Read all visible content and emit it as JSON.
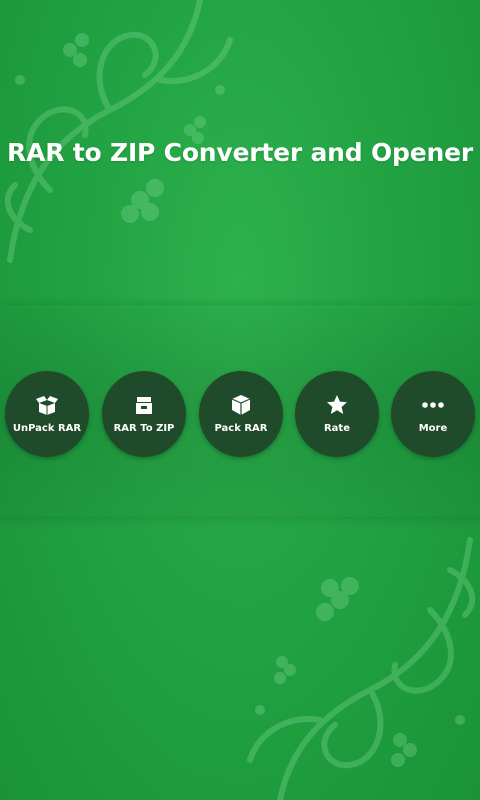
{
  "app": {
    "title": "RAR to ZIP Converter and Opener"
  },
  "actions": [
    {
      "label": "UnPack RAR",
      "icon": "open-box-icon"
    },
    {
      "label": "RAR To ZIP",
      "icon": "archive-box-icon"
    },
    {
      "label": "Pack RAR",
      "icon": "cube-box-icon"
    },
    {
      "label": "Rate",
      "icon": "star-icon"
    },
    {
      "label": "More",
      "icon": "more-dots-icon"
    }
  ],
  "colors": {
    "background": "#22a343",
    "button": "#1f4b2b",
    "text": "#ffffff"
  }
}
